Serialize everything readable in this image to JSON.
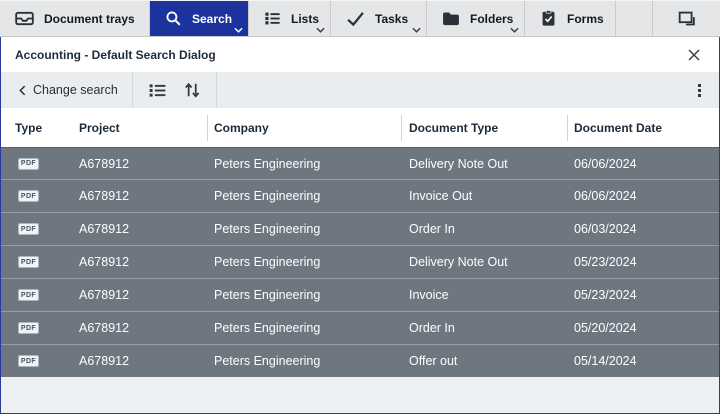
{
  "nav": {
    "tabs": [
      {
        "label": "Document trays",
        "icon": "inbox-tray-icon",
        "active": false,
        "has_chevron": false
      },
      {
        "label": "Search",
        "icon": "search-icon",
        "active": true,
        "has_chevron": true
      },
      {
        "label": "Lists",
        "icon": "list-icon",
        "active": false,
        "has_chevron": true
      },
      {
        "label": "Tasks",
        "icon": "checkmark-icon",
        "active": false,
        "has_chevron": true
      },
      {
        "label": "Folders",
        "icon": "folder-icon",
        "active": false,
        "has_chevron": true
      },
      {
        "label": "Forms",
        "icon": "clipboard-check-icon",
        "active": false,
        "has_chevron": false
      }
    ]
  },
  "dialog": {
    "title": "Accounting - Default Search Dialog"
  },
  "toolbar": {
    "change_search_label": "Change search"
  },
  "table": {
    "columns": [
      "Type",
      "Project",
      "Company",
      "Document Type",
      "Document Date"
    ],
    "rows": [
      {
        "type": "PDF",
        "project": "A678912",
        "company": "Peters Engineering",
        "document_type": "Delivery Note Out",
        "document_date": "06/06/2024"
      },
      {
        "type": "PDF",
        "project": "A678912",
        "company": "Peters Engineering",
        "document_type": "Invoice Out",
        "document_date": "06/06/2024"
      },
      {
        "type": "PDF",
        "project": "A678912",
        "company": "Peters Engineering",
        "document_type": "Order In",
        "document_date": "06/03/2024"
      },
      {
        "type": "PDF",
        "project": "A678912",
        "company": "Peters Engineering",
        "document_type": "Delivery Note Out",
        "document_date": "05/23/2024"
      },
      {
        "type": "PDF",
        "project": "A678912",
        "company": "Peters Engineering",
        "document_type": "Invoice",
        "document_date": "05/23/2024"
      },
      {
        "type": "PDF",
        "project": "A678912",
        "company": "Peters Engineering",
        "document_type": "Order In",
        "document_date": "05/20/2024"
      },
      {
        "type": "PDF",
        "project": "A678912",
        "company": "Peters Engineering",
        "document_type": "Offer out",
        "document_date": "05/14/2024"
      }
    ]
  },
  "colors": {
    "accent_blue": "#1c339e",
    "dialog_border": "#2c3aa0",
    "row_gray": "#6e7680",
    "navbar_gray": "#e5e6e7",
    "toolbar_gray": "#e9edef",
    "header_text": "#1e2b3a"
  }
}
